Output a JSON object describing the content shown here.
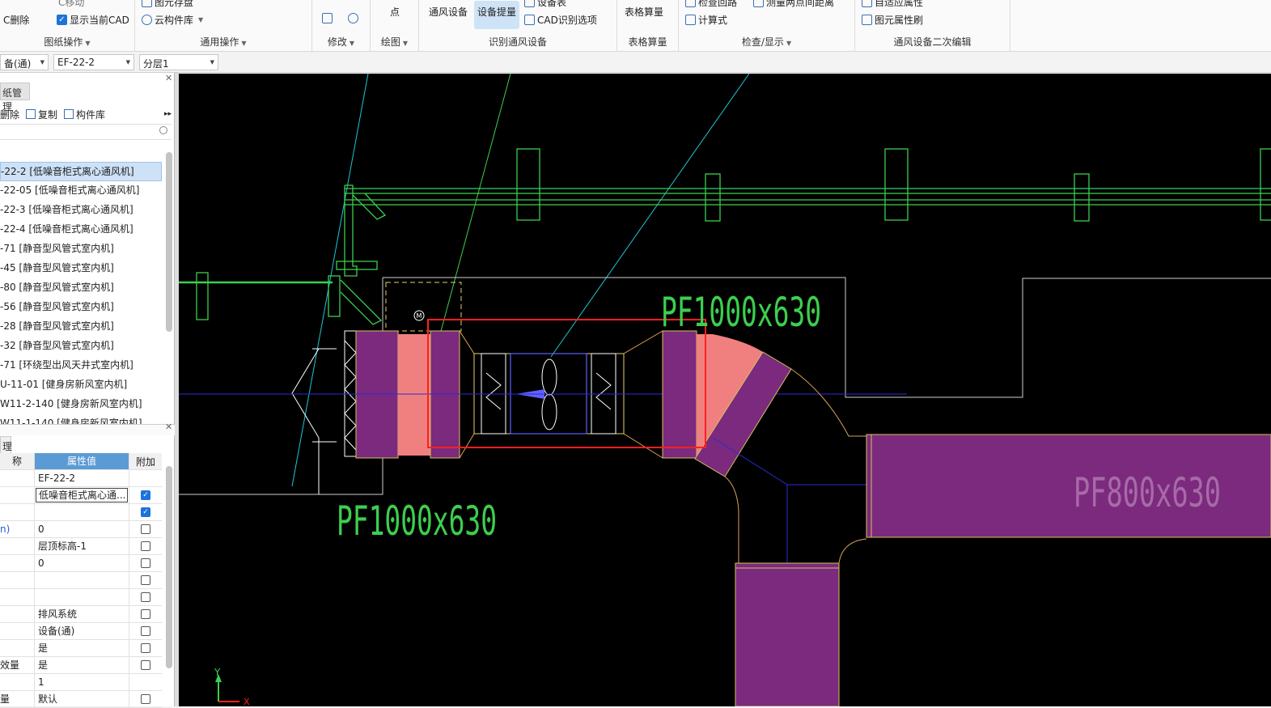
{
  "ribbon": {
    "groups": [
      {
        "label": "图纸操作"
      },
      {
        "label": "通用操作"
      },
      {
        "label": "修改"
      },
      {
        "label": "绘图"
      },
      {
        "label": "识别通风设备"
      },
      {
        "label": "表格算量"
      },
      {
        "label": "检查/显示"
      },
      {
        "label": "通风设备二次编辑"
      }
    ],
    "items": {
      "cad_delete": "C删除",
      "show_cad": "显示当前CAD",
      "move": "C移动",
      "elem_store": "图元存盘",
      "component_lib": "云构件库",
      "point": "点",
      "vent_equipment": "通风设备",
      "equipment_extract": "设备提量",
      "equipment_table": "设备表",
      "cad_options": "CAD识别选项",
      "table_calc": "表格算量",
      "check_loop": "检查回路",
      "calc_formula": "计算式",
      "measure_distance": "测量两点间距离",
      "adaptive_attr": "自适应属性",
      "attr_brush": "图元属性刷"
    }
  },
  "selectors": {
    "category": "备(通)",
    "component": "EF-22-2",
    "layer": "分层1"
  },
  "left_panel": {
    "tab_label": "纸管理",
    "toolbar": {
      "delete": "删除",
      "copy": "复制",
      "library": "构件库"
    },
    "items": [
      "-22-2 [低噪音柜式离心通风机]",
      "-22-05 [低噪音柜式离心通风机]",
      "-22-3 [低噪音柜式离心通风机]",
      "-22-4 [低噪音柜式离心通风机]",
      "-71 [静音型风管式室内机]",
      "-45 [静音型风管式室内机]",
      "-80 [静音型风管式室内机]",
      "-56 [静音型风管式室内机]",
      "-28 [静音型风管式室内机]",
      "-32 [静音型风管式室内机]",
      "-71 [环绕型出风天井式室内机]",
      "U-11-01 [健身房新风室内机]",
      "W11-2-140 [健身房新风室内机]",
      "W11-1-140 [健身房新风室内机]"
    ]
  },
  "props_panel": {
    "tab_label": "理",
    "headers": {
      "name": "称",
      "value": "属性值",
      "extra": "附加"
    },
    "rows": [
      {
        "name": "",
        "value": "EF-22-2",
        "check": null
      },
      {
        "name": "",
        "value": "低噪音柜式离心通...",
        "check": true,
        "editing": true
      },
      {
        "name": "",
        "value": "",
        "check": true
      },
      {
        "name": "n)",
        "value": "0",
        "check": false
      },
      {
        "name": "",
        "value": "层顶标高-1",
        "check": false
      },
      {
        "name": "",
        "value": "0",
        "check": false
      },
      {
        "name": "",
        "value": "",
        "check": false
      },
      {
        "name": "",
        "value": "",
        "check": false
      },
      {
        "name": "",
        "value": "排风系统",
        "check": false
      },
      {
        "name": "",
        "value": "设备(通)",
        "check": false
      },
      {
        "name": "",
        "value": "是",
        "check": false
      },
      {
        "name": "效量",
        "value": "是",
        "check": false
      },
      {
        "name": "",
        "value": "1",
        "check": null
      },
      {
        "name": "量",
        "value": "默认",
        "check": false
      }
    ]
  },
  "canvas": {
    "labels": {
      "duct_top": "PF1000x630",
      "duct_bottom": "PF1000x630",
      "duct_right": "PF800x630",
      "motor": "M",
      "axis_y": "Y",
      "axis_x": "X"
    },
    "colors": {
      "background": "#000000",
      "duct_fill": "#7b2a7e",
      "transition_fill": "#f08080",
      "green": "#3ccf4e",
      "cyan": "#1fc6d6",
      "selection": "#ff2020",
      "fan": "#6060ff"
    }
  }
}
